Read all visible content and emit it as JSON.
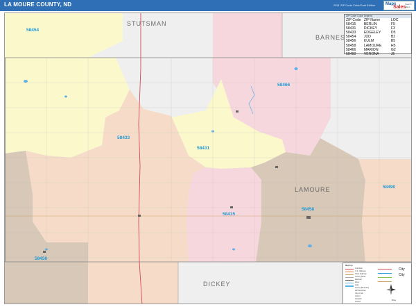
{
  "header": {
    "title": "LA MOURE COUNTY, ND",
    "edition": "2021 ZIP Code Color/Cast Edition",
    "logo": {
      "line1": "Maps",
      "line2": "Sales",
      "line3": "Search Maps"
    }
  },
  "legend": {
    "caption": "ZIP Code Color Legend",
    "headers": [
      "ZIP Code",
      "ZIP Name",
      "LOC"
    ],
    "rows": [
      [
        "58415",
        "BERLIN",
        "F5"
      ],
      [
        "58431",
        "DICKEY",
        "F3"
      ],
      [
        "58433",
        "EDGELEY",
        "D5"
      ],
      [
        "58454",
        "JUD",
        "B2"
      ],
      [
        "58456",
        "KULM",
        "B5"
      ],
      [
        "58458",
        "LAMOURE",
        "H5"
      ],
      [
        "58466",
        "MARION",
        "G2"
      ],
      [
        "58490",
        "VERONA",
        "J5"
      ]
    ]
  },
  "map": {
    "zip_labels": [
      "58454",
      "58433",
      "58431",
      "58466",
      "58415",
      "58458",
      "58490",
      "58456"
    ],
    "county_labels": [
      "STUTSMAN",
      "BARNES",
      "LAMOURE",
      "DICKEY"
    ],
    "colors": {
      "yellow": "#fbf8cc",
      "pink": "#f7d7de",
      "tan": "#d7c8b7",
      "peach": "#f6dcc8",
      "gray": "#efefef",
      "zip_label": "#1f9ad6",
      "county_label": "#6a6a6a",
      "highway": "#d24a5a",
      "water": "#5fb0e8"
    }
  },
  "map_key": {
    "heading": "Map Key",
    "items": [
      "Interstate",
      "U.S. Highway",
      "State Highway",
      "County Road",
      "Railroad",
      "River",
      "Lake",
      "County Boundary",
      "ZIP Boundary",
      "City Limits",
      "Airport",
      "Hospital",
      "School"
    ],
    "city_label": "City",
    "scale_label": "Miles"
  }
}
